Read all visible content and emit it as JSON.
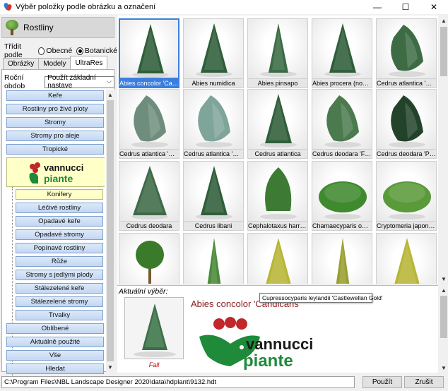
{
  "window": {
    "title": "Výběr položky podle obrázku a označení",
    "minimize": "—",
    "maximize": "☐",
    "close": "✕"
  },
  "left": {
    "header": "Rostliny",
    "sort_label": "Třídit podle",
    "sort_options": [
      "Obecné",
      "Botanické"
    ],
    "sort_selected": "Botanické",
    "tabs": [
      "Obrázky",
      "Modely",
      "UltraRes"
    ],
    "active_tab": "UltraRes",
    "season_label": "Roční obdob",
    "season_value": "Použít základní nastave",
    "categories_top": [
      "Keře",
      "Rostliny pro živé ploty",
      "Stromy",
      "Stromy pro aleje",
      "Tropické"
    ],
    "brand_small": "vannucci piante",
    "subcategories": [
      "Konifery",
      "Léčivé rostliny",
      "Opadavé keře",
      "Opadavé stromy",
      "Popínavé rostliny",
      "Růže",
      "Stromy s jedlými plody",
      "Stálezelené keře",
      "Stálezelené stromy",
      "Trvalky"
    ],
    "categories_bottom": [
      "Oblíbené",
      "Aktuálně použité",
      "Vše",
      "Hledat"
    ]
  },
  "grid": {
    "items": [
      {
        "name": "Abies concolor 'Candi...",
        "selected": true
      },
      {
        "name": "Abies numidica"
      },
      {
        "name": "Abies pinsapo"
      },
      {
        "name": "Abies procera (nobilis)..."
      },
      {
        "name": "Cedrus atlantica 'Com..."
      },
      {
        "name": "Cedrus atlantica 'Glau..."
      },
      {
        "name": "Cedrus atlantica 'Glau..."
      },
      {
        "name": "Cedrus atlantica"
      },
      {
        "name": "Cedrus deodara 'Feeli..."
      },
      {
        "name": "Cedrus deodara 'Pen..."
      },
      {
        "name": "Cedrus deodara"
      },
      {
        "name": "Cedrus libani"
      },
      {
        "name": "Cephalotaxus harringt..."
      },
      {
        "name": "Chamaecyparis obtus..."
      },
      {
        "name": "Cryptomeria japonica '..."
      },
      {
        "name": ""
      },
      {
        "name": ""
      },
      {
        "name": ""
      },
      {
        "name": ""
      },
      {
        "name": ""
      }
    ]
  },
  "current": {
    "label": "Aktuální výběr:",
    "name": "Abies concolor 'Candicans'",
    "season": "Fall",
    "tooltip": "Cupressocyparis leylandii 'Castlewellan Gold'",
    "brand_large_top": "vannucci",
    "brand_large_bottom": "piante"
  },
  "status": {
    "path": "C:\\Program Files\\NBL Landscape Designer 2020\\data\\hdplant\\9132.hdt",
    "apply_label": "Použít",
    "cancel_label": "Zrušit"
  },
  "colors": {
    "selection": "#3a7ee0",
    "category_btn": "#c3d7f2",
    "highlight_yellow": "#ffffc8",
    "brand_red": "#c0282b",
    "brand_green": "#1e8a3a"
  }
}
